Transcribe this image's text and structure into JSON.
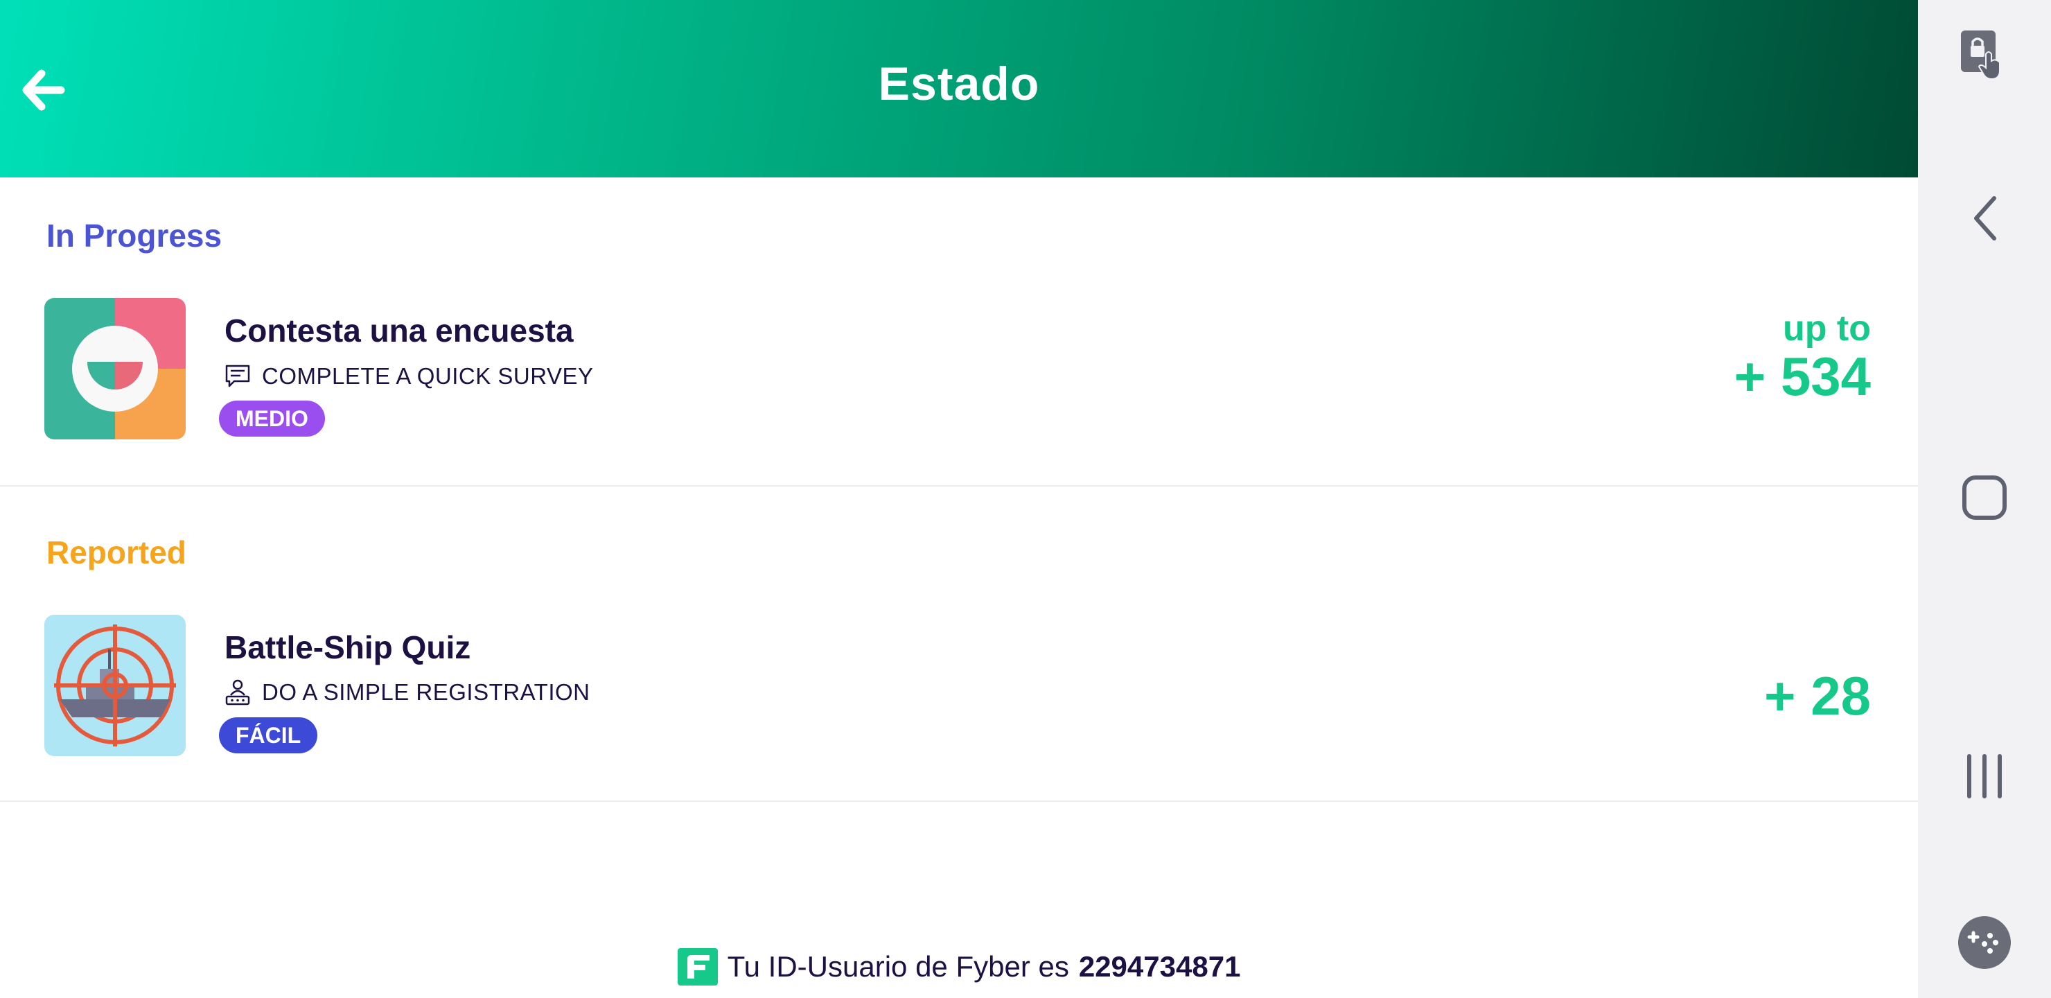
{
  "header": {
    "title": "Estado"
  },
  "sections": [
    {
      "title": "In Progress",
      "color": "#4b55d4",
      "offer": {
        "title": "Contesta una encuesta",
        "description": "COMPLETE A QUICK SURVEY",
        "description_icon": "survey-icon",
        "difficulty": "MEDIO",
        "difficulty_color": "#9b4ef0",
        "reward_prefix": "up to",
        "reward": "+ 534"
      }
    },
    {
      "title": "Reported",
      "color": "#f5a41c",
      "offer": {
        "title": "Battle-Ship Quiz",
        "description": "DO A SIMPLE REGISTRATION",
        "description_icon": "registration-icon",
        "difficulty": "FÁCIL",
        "difficulty_color": "#3d4ad8",
        "reward": "+ 28"
      }
    }
  ],
  "footer": {
    "text": "Tu ID-Usuario de Fyber es",
    "user_id": "2294734871",
    "logo_icon": "fyber-logo-icon"
  },
  "system_nav": {
    "items": [
      "lock-touch-icon",
      "back-chevron-icon",
      "home-square-icon",
      "recent-apps-icon",
      "game-tools-icon"
    ]
  },
  "colors": {
    "accent_green": "#16c98a",
    "text_dark": "#1c1142"
  }
}
